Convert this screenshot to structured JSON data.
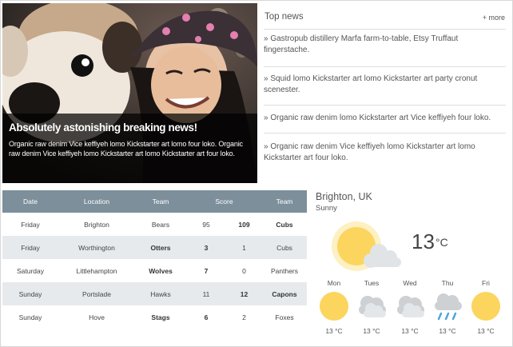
{
  "hero": {
    "title": "Absolutely astonishing breaking news!",
    "text": "Organic raw denim Vice keffiyeh lomo Kickstarter art lomo four loko. Organic raw denim Vice keffiyeh lomo Kickstarter art lomo Kickstarter art four loko."
  },
  "top_news": {
    "title": "Top news",
    "more_label": "+ more",
    "items": [
      "» Gastropub distillery Marfa farm-to-table, Etsy Truffaut fingerstache.",
      "» Squid lomo Kickstarter art lomo Kickstarter art party cronut scenester.",
      "» Organic raw denim lomo Kickstarter art Vice keffiyeh four loko.",
      "» Organic raw denim Vice keffiyeh lomo Kickstarter art lomo Kickstarter art four loko."
    ]
  },
  "scores": {
    "headers": [
      "Date",
      "Location",
      "Team",
      "Score",
      "Team"
    ],
    "rows": [
      {
        "date": "Friday",
        "location": "Brighton",
        "home": "Bears",
        "home_score": "95",
        "away_score": "109",
        "away": "Cubs"
      },
      {
        "date": "Friday",
        "location": "Worthington",
        "home": "Otters",
        "home_score": "3",
        "away_score": "1",
        "away": "Cubs"
      },
      {
        "date": "Saturday",
        "location": "Littlehampton",
        "home": "Wolves",
        "home_score": "7",
        "away_score": "0",
        "away": "Panthers"
      },
      {
        "date": "Sunday",
        "location": "Portslade",
        "home": "Hawks",
        "home_score": "11",
        "away_score": "12",
        "away": "Capons"
      },
      {
        "date": "Sunday",
        "location": "Hove",
        "home": "Stags",
        "home_score": "6",
        "away_score": "2",
        "away": "Foxes"
      }
    ]
  },
  "weather": {
    "city": "Brighton, UK",
    "condition": "Sunny",
    "temp": "13",
    "temp_unit": "°C",
    "current_icon": "sun-behind-cloud-icon",
    "forecast": [
      {
        "day": "Mon",
        "icon": "sun-icon",
        "temp": "13 °C"
      },
      {
        "day": "Tues",
        "icon": "cloud-icon",
        "temp": "13 °C"
      },
      {
        "day": "Wed",
        "icon": "cloud-icon",
        "temp": "13 °C"
      },
      {
        "day": "Thu",
        "icon": "rain-cloud-icon",
        "temp": "13 °C"
      },
      {
        "day": "Fri",
        "icon": "sun-icon",
        "temp": "13 °C"
      }
    ],
    "colors": {
      "sun": "#fbd55e",
      "sun_glow": "#fdeeb0",
      "cloud": "#cfd3d6",
      "rain": "#4aa6d8"
    }
  }
}
